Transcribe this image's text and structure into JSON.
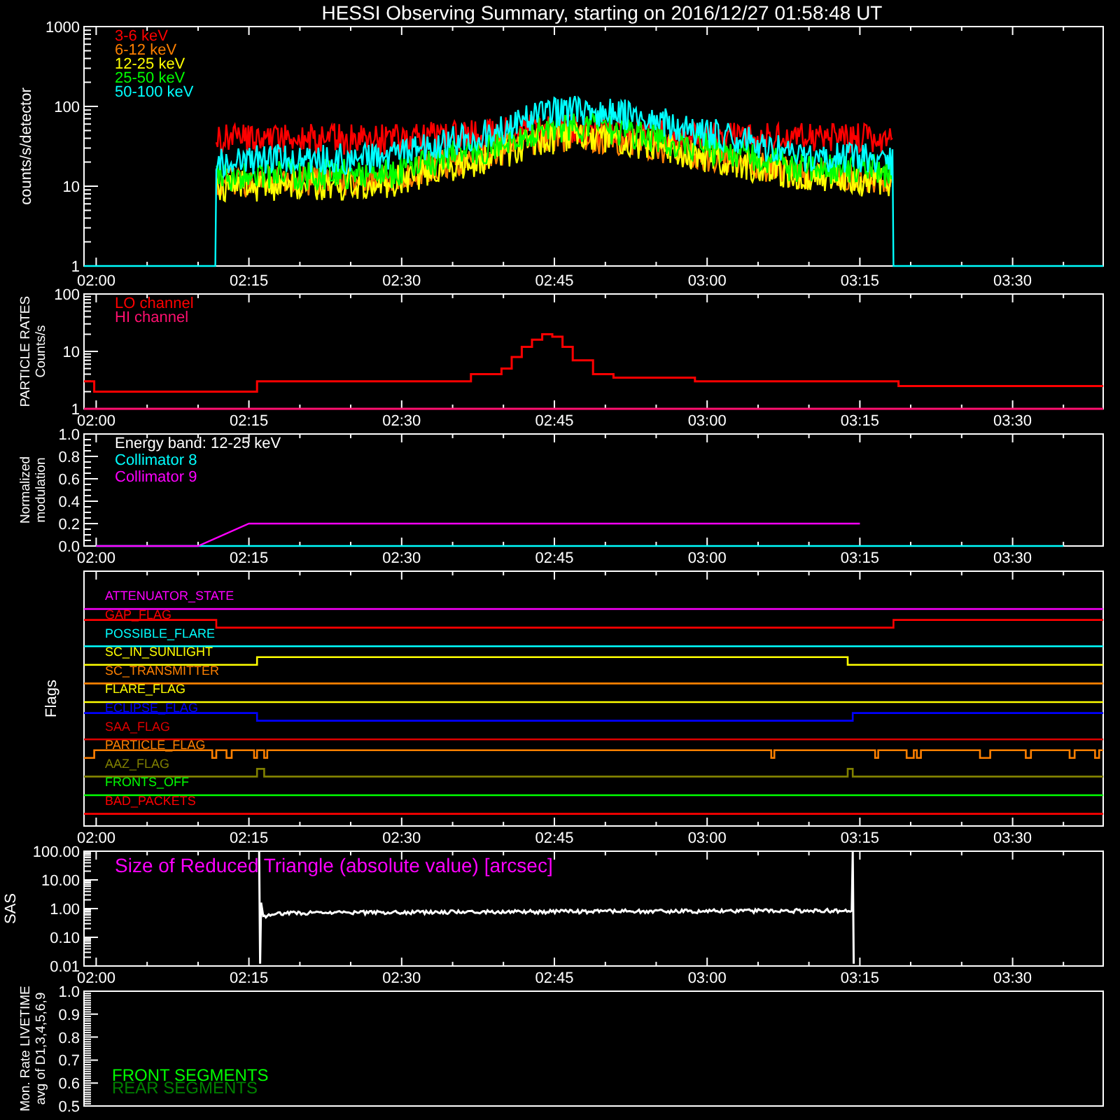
{
  "title": "HESSI Observing Summary, starting on 2016/12/27 01:58:48 UT",
  "panels": [
    {
      "kind": "lightcurve",
      "ylabel_lines": [
        "counts/s/detector"
      ],
      "yticks": [
        "1000",
        "100",
        "10",
        "1"
      ],
      "xticks": [
        "02:00",
        "02:15",
        "02:30",
        "02:45",
        "03:00",
        "03:15",
        "03:30"
      ],
      "legend": [
        {
          "label": "3-6 keV",
          "color": "#ff0000"
        },
        {
          "label": "6-12 keV",
          "color": "#ff8000"
        },
        {
          "label": "12-25 keV",
          "color": "#ffff00"
        },
        {
          "label": "25-50 keV",
          "color": "#00ff00"
        },
        {
          "label": "50-100 keV",
          "color": "#00ffff"
        }
      ]
    },
    {
      "kind": "rates",
      "ylabel_lines": [
        "PARTICLE RATES",
        "Counts/s"
      ],
      "yticks": [
        "100",
        "10",
        "1"
      ],
      "xticks": [
        "02:00",
        "02:15",
        "02:30",
        "02:45",
        "03:00",
        "03:15",
        "03:30"
      ],
      "legend": [
        {
          "label": "LO channel",
          "color": "#ff0000"
        },
        {
          "label": "HI channel",
          "color": "#ff1070"
        }
      ]
    },
    {
      "kind": "modulation",
      "ylabel_lines": [
        "Normalized",
        "modulation"
      ],
      "note": "Energy band: 12-25 keV",
      "chart_data": {
        "type": "line",
        "categories": [
          "02:00",
          null,
          null,
          "02:15",
          null,
          null,
          "02:30",
          null,
          null,
          "02:45",
          null,
          null,
          "03:00",
          null,
          null,
          "03:15",
          null,
          null,
          "03:30",
          null
        ],
        "ylim": [
          0,
          1
        ],
        "yticks": [
          {
            "value": 0,
            "label": "0.0"
          },
          {
            "value": 0.2,
            "label": "0.2"
          },
          {
            "value": 0.4,
            "label": "0.4"
          },
          {
            "value": 0.6,
            "label": "0.6"
          },
          {
            "value": 0.8,
            "label": "0.8"
          },
          {
            "value": 1,
            "label": "1.0"
          }
        ],
        "series": [
          {
            "name": "Collimator 8",
            "color": "#00ffff",
            "values": [
              0,
              0,
              0,
              0,
              0,
              0,
              0,
              0,
              0,
              0,
              0,
              0,
              0,
              0,
              0,
              0,
              0,
              0,
              0,
              0
            ]
          },
          {
            "name": "Collimator 9",
            "color": "#ff00ff",
            "values": [
              0,
              0,
              0,
              0.2,
              0.2,
              0.2,
              0.2,
              0.2,
              0.2,
              0.2,
              0.2,
              0.2,
              0.2,
              0.2,
              0.2,
              0.2,
              null,
              null,
              null,
              null
            ]
          }
        ]
      }
    },
    {
      "kind": "flags",
      "ylabel_lines": [
        "Flags"
      ],
      "xticks": [
        "02:00",
        "02:15",
        "02:30",
        "02:45",
        "03:00",
        "03:15",
        "03:30"
      ],
      "flags": [
        {
          "name": "ATTENUATOR_STATE",
          "color": "#ff00ff"
        },
        {
          "name": "GAP_FLAG",
          "color": "#ff0000"
        },
        {
          "name": "POSSIBLE_FLARE",
          "color": "#00ffff"
        },
        {
          "name": "SC_IN_SUNLIGHT",
          "color": "#ffff00"
        },
        {
          "name": "SC_TRANSMITTER",
          "color": "#ff8000"
        },
        {
          "name": "FLARE_FLAG",
          "color": "#ffff00"
        },
        {
          "name": "ECLIPSE_FLAG",
          "color": "#0000ff"
        },
        {
          "name": "SAA_FLAG",
          "color": "#e00000"
        },
        {
          "name": "PARTICLE_FLAG",
          "color": "#ff8000"
        },
        {
          "name": "AAZ_FLAG",
          "color": "#808000"
        },
        {
          "name": "FRONTS_OFF",
          "color": "#00ff00"
        },
        {
          "name": "BAD_PACKETS",
          "color": "#ff0000"
        }
      ]
    },
    {
      "kind": "sas",
      "ylabel_lines": [
        "SAS"
      ],
      "title": "Size of Reduced Triangle (absolute value) [arcsec]",
      "yticks": [
        "100.00",
        "10.00",
        "1.00",
        "0.10",
        "0.01"
      ],
      "xticks": [
        "02:00",
        "02:15",
        "02:30",
        "02:45",
        "03:00",
        "03:15",
        "03:30"
      ]
    },
    {
      "kind": "livetime",
      "ylabel_lines": [
        "Mon. Rate LIVETIME",
        "avg of D1,3,4,5,6,9"
      ],
      "yticks": [
        "1.0",
        "0.9",
        "0.8",
        "0.7",
        "0.6",
        "0.5"
      ],
      "legend": [
        {
          "label": "FRONT SEGMENTS",
          "color": "#00ff00"
        },
        {
          "label": "REAR SEGMENTS",
          "color": "#008000"
        }
      ]
    }
  ]
}
